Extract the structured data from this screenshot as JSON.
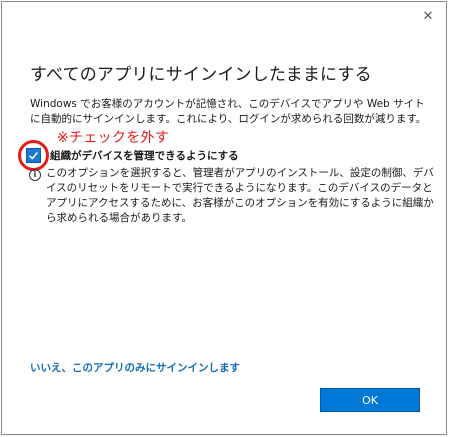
{
  "dialog": {
    "close_glyph": "✕",
    "title": "すべてのアプリにサインインしたままにする",
    "description": "Windows でお客様のアカウントが記憶され、このデバイスでアプリや Web サイトに自動的にサインインします。これにより、ログインが求められる回数が減ります。",
    "annotation": "※チェックを外す",
    "checkbox": {
      "label": "組織がデバイスを管理できるようにする",
      "checked": true
    },
    "info_icon": "i",
    "info_text": "このオプションを選択すると、管理者がアプリのインストール、設定の制御、デバイスのリセットをリモートで実行できるようになります。このデバイスのデータとアプリにアクセスするために、お客様がこのオプションを有効にするように組織から求められる場合があります。",
    "link": "いいえ、このアプリのみにサインインします",
    "ok_button": "OK"
  },
  "colors": {
    "accent": "#0078d7",
    "link": "#0f6cbd",
    "annotation": "#e81a1a",
    "checkbox_fill": "#1a78d6"
  }
}
